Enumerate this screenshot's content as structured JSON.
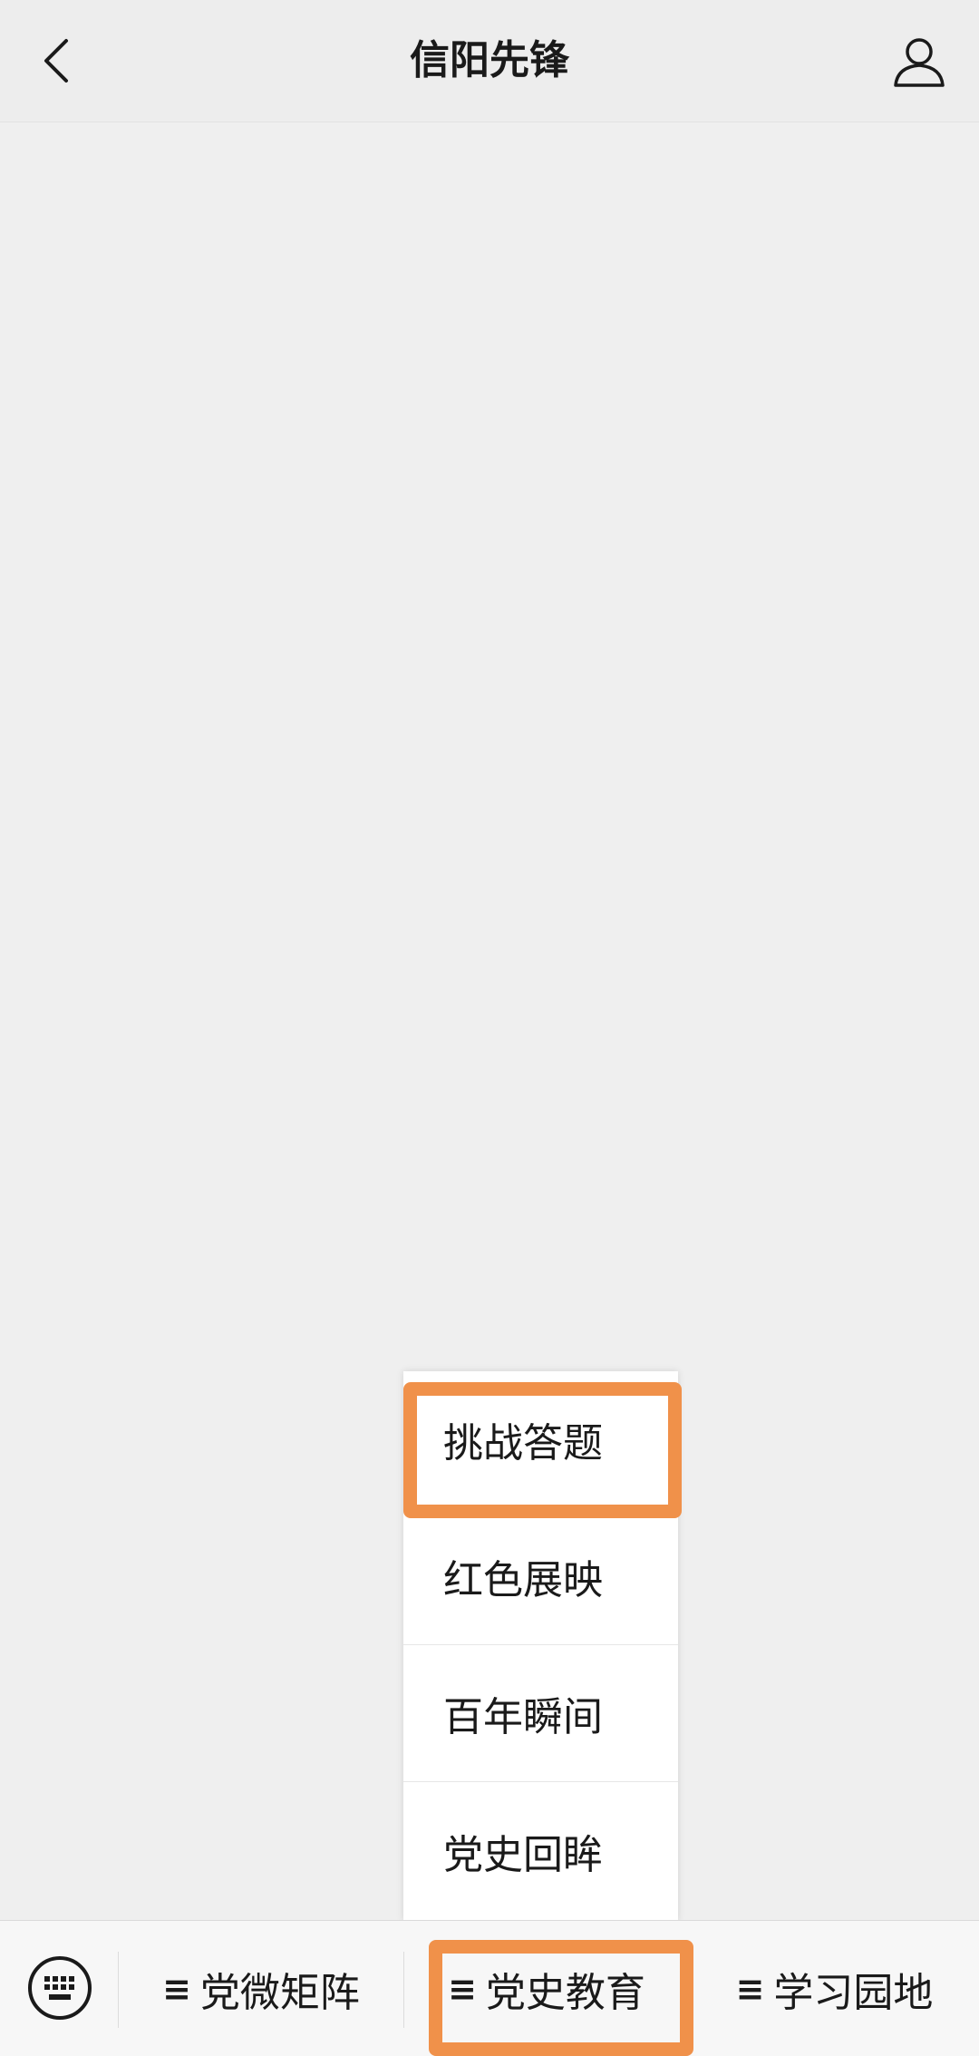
{
  "header": {
    "title": "信阳先锋",
    "back_icon": "chevron-left-icon",
    "profile_icon": "user-icon"
  },
  "submenu": {
    "items": [
      {
        "label": "挑战答题"
      },
      {
        "label": "红色展映"
      },
      {
        "label": "百年瞬间"
      },
      {
        "label": "党史回眸"
      }
    ]
  },
  "bottom_menu": {
    "keyboard_icon": "keyboard-icon",
    "menu_glyph": "≡",
    "tabs": [
      {
        "label": "党微矩阵"
      },
      {
        "label": "党史教育"
      },
      {
        "label": "学习园地"
      }
    ]
  },
  "colors": {
    "highlight": "#f0914a",
    "background": "#efefef"
  }
}
